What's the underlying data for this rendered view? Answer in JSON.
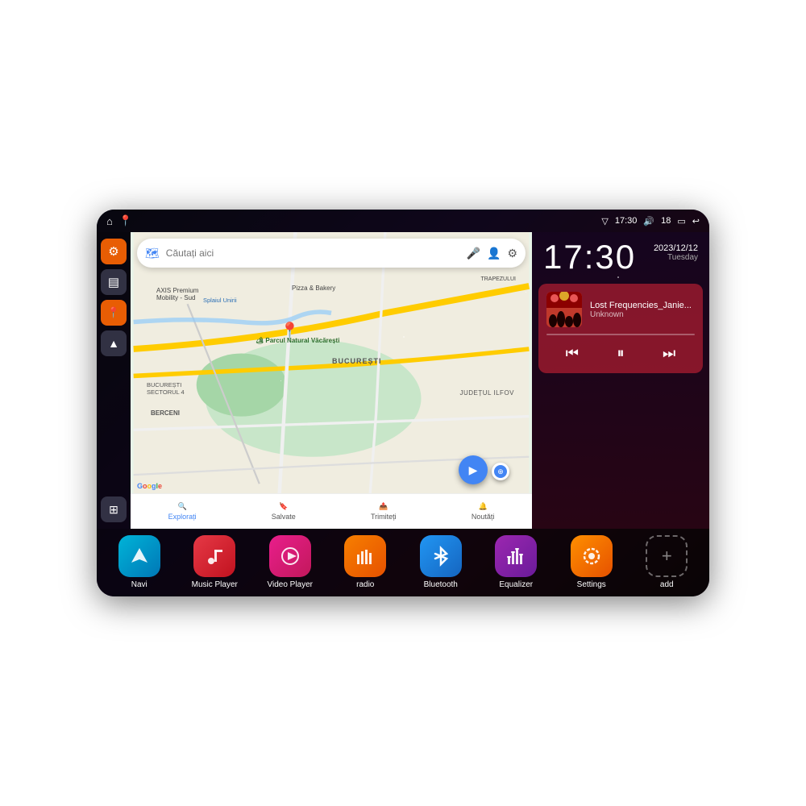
{
  "device": {
    "status_bar": {
      "wifi_icon": "▼",
      "time": "17:30",
      "volume_icon": "🔊",
      "battery_level": "18",
      "battery_icon": "🔋",
      "back_icon": "↩"
    },
    "sidebar": {
      "settings_icon": "⚙",
      "files_icon": "▤",
      "maps_icon": "📍",
      "navigate_icon": "▲",
      "apps_icon": "⊞"
    },
    "map": {
      "search_placeholder": "Căutați aici",
      "nav_items": [
        {
          "label": "Explorați",
          "icon": "🔍"
        },
        {
          "label": "Salvate",
          "icon": "🔖"
        },
        {
          "label": "Trimiteți",
          "icon": "📤"
        },
        {
          "label": "Noutăți",
          "icon": "🔔"
        }
      ],
      "places": [
        "AXIS Premium Mobility - Sud",
        "Pizza & Bakery",
        "Parcul Natural Văcărești",
        "BUCUREȘTI",
        "BUCUREȘTI SECTORUL 4",
        "BERCENI",
        "JUDEȚUL ILFOV",
        "TRAPEZULUI"
      ]
    },
    "clock": {
      "time": "17:30",
      "date": "2023/12/12",
      "day": "Tuesday"
    },
    "music": {
      "title": "Lost Frequencies_Janie...",
      "artist": "Unknown",
      "prev_icon": "⏮",
      "pause_icon": "⏸",
      "next_icon": "⏭"
    },
    "apps": [
      {
        "label": "Navi",
        "icon_color": "teal",
        "icon_char": "▲"
      },
      {
        "label": "Music Player",
        "icon_color": "red",
        "icon_char": "♪"
      },
      {
        "label": "Video Player",
        "icon_color": "pink",
        "icon_char": "▶"
      },
      {
        "label": "radio",
        "icon_color": "orange",
        "icon_char": "📻"
      },
      {
        "label": "Bluetooth",
        "icon_color": "blue",
        "icon_char": "Ᵽ"
      },
      {
        "label": "Equalizer",
        "icon_color": "purple",
        "icon_char": "≡"
      },
      {
        "label": "Settings",
        "icon_color": "amber",
        "icon_char": "⚙"
      },
      {
        "label": "add",
        "icon_color": "outlined",
        "icon_char": "+"
      }
    ]
  }
}
